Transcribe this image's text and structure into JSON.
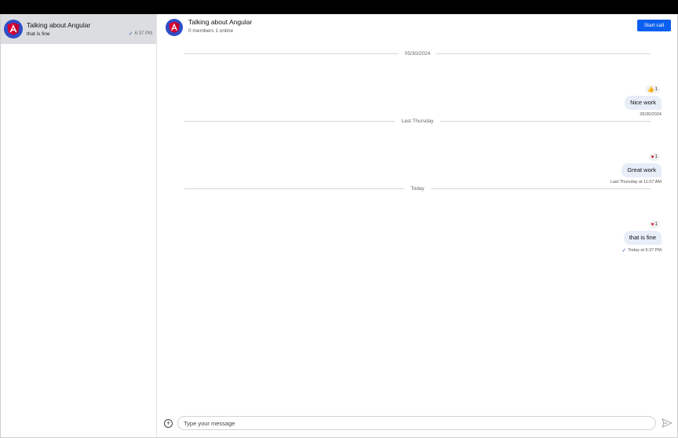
{
  "sidebar": {
    "channel": {
      "name": "Talking about Angular",
      "preview": "that is fine",
      "time": "6:37 PM"
    }
  },
  "header": {
    "title": "Talking about Angular",
    "subtitle": "0 members 1 online",
    "start_call_label": "Start call"
  },
  "messages": [
    {
      "divider": "05/30/2024",
      "reaction_icon": "thumbs-up",
      "reaction_count": "1",
      "text": "Nice work",
      "meta": "05/30/2024"
    },
    {
      "divider": "Last Thursday",
      "reaction_icon": "heart",
      "reaction_count": "1",
      "text": "Great work",
      "meta": "Last Thursday at 11:07 AM"
    },
    {
      "divider": "Today",
      "reaction_icon": "heart",
      "reaction_count": "1",
      "text": "that is fine",
      "meta": "Today at 6:37 PM"
    }
  ],
  "composer": {
    "placeholder": "Type your message"
  },
  "colors": {
    "accent": "#0a5ff0",
    "avatar_bg": "#2f4ec7",
    "angular_red": "#dd0031",
    "bubble_bg": "#e7eef8",
    "selected_channel_bg": "#dcdde0"
  }
}
